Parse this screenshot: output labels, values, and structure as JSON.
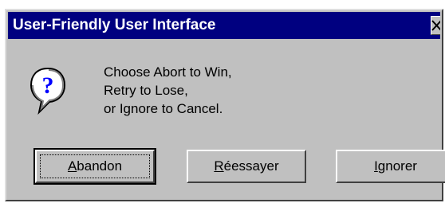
{
  "dialog": {
    "title": "User-Friendly User Interface",
    "icon": "question-icon",
    "message_lines": [
      "Choose Abort to Win,",
      "Retry to Lose,",
      "or Ignore to Cancel."
    ]
  },
  "buttons": [
    {
      "label_underlined": "A",
      "label_rest": "bandon"
    },
    {
      "label_underlined": "R",
      "label_rest": "éessayer"
    },
    {
      "label_underlined": "I",
      "label_rest": "gnorer"
    }
  ],
  "colors": {
    "titlebar": "#000080",
    "face": "#c0c0c0",
    "title_text": "#ffffff"
  }
}
